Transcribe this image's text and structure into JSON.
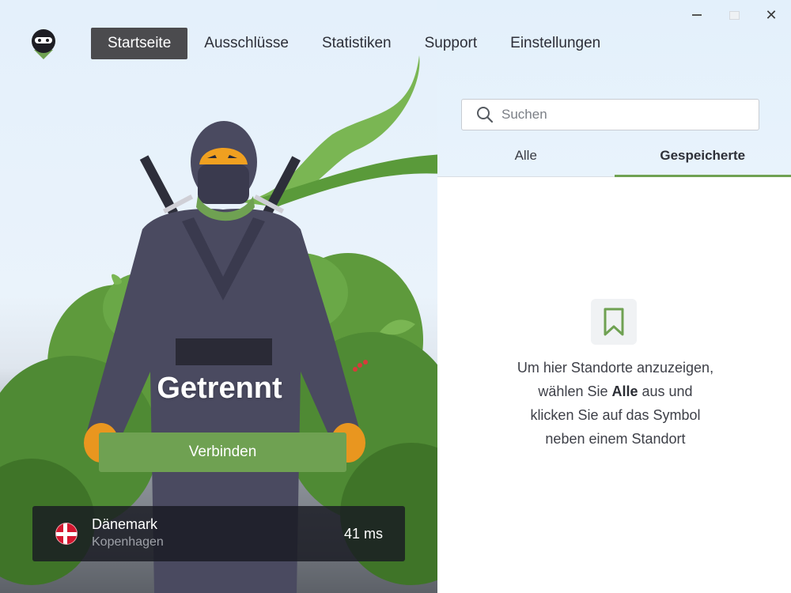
{
  "window": {
    "minimize_icon": "minimize-icon",
    "maximize_icon": "maximize-icon",
    "close_icon": "close-icon",
    "close_glyph": "✕"
  },
  "nav": {
    "items": [
      {
        "label": "Startseite",
        "active": true
      },
      {
        "label": "Ausschlüsse",
        "active": false
      },
      {
        "label": "Statistiken",
        "active": false
      },
      {
        "label": "Support",
        "active": false
      },
      {
        "label": "Einstellungen",
        "active": false
      }
    ]
  },
  "search": {
    "placeholder": "Suchen",
    "icon": "search-icon"
  },
  "tabs": [
    {
      "label": "Alle",
      "active": false
    },
    {
      "label": "Gespeicherte",
      "active": true
    }
  ],
  "empty_state": {
    "icon": "bookmark-icon",
    "line1": "Um hier Standorte anzuzeigen,",
    "line2_pre": "wählen Sie ",
    "line2_bold": "Alle",
    "line2_post": " aus und",
    "line3": "klicken Sie auf das Symbol",
    "line4": "neben einem Standort"
  },
  "connection": {
    "status": "Getrennt",
    "button_label": "Verbinden"
  },
  "location": {
    "country": "Dänemark",
    "city": "Kopenhagen",
    "ping": "41 ms",
    "flag_icon": "denmark-flag-icon"
  },
  "colors": {
    "accent": "#6fa152",
    "nav_active_bg": "#4b4b4e",
    "ninja_body": "#4a4a60",
    "ninja_skin": "#f0a020"
  }
}
